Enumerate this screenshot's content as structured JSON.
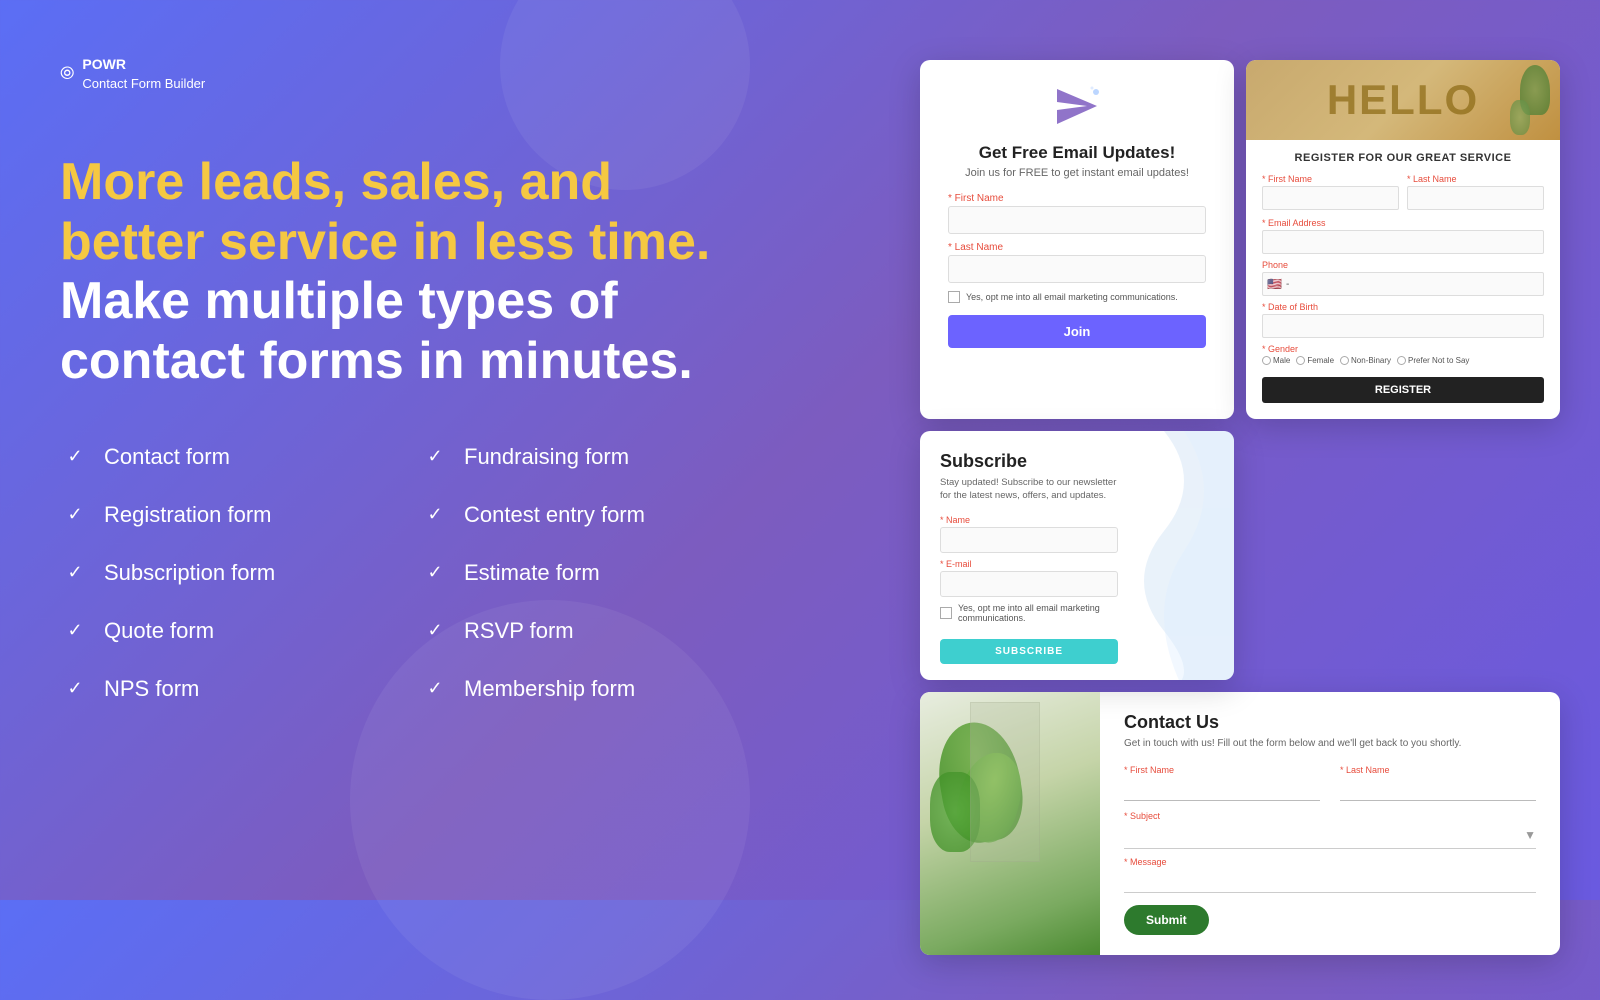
{
  "logo": {
    "icon": "⦾",
    "brand": "POWR",
    "subtitle": "Contact Form Builder"
  },
  "headline": {
    "part1": "More leads, sales, and better service in less time.",
    "part2": "Make multiple types of contact forms in minutes."
  },
  "features": {
    "col1": [
      "Contact form",
      "Registration form",
      "Subscription form",
      "Quote form",
      "NPS form"
    ],
    "col2": [
      "Fundraising form",
      "Contest entry form",
      "Estimate form",
      "RSVP form",
      "Membership form"
    ]
  },
  "form1": {
    "title": "Get Free Email Updates!",
    "subtitle": "Join us for FREE to get instant email updates!",
    "field1_label": "* First Name",
    "field2_label": "* Last Name",
    "checkbox_label": "Yes, opt me into all email marketing communications.",
    "button": "Join"
  },
  "form2": {
    "header_text": "HELLO",
    "title": "REGISTER FOR OUR GREAT SERVICE",
    "first_name_label": "* First Name",
    "last_name_label": "* Last Name",
    "email_label": "* Email Address",
    "phone_label": "Phone",
    "dob_label": "* Date of Birth",
    "gender_label": "* Gender",
    "genders": [
      "Male",
      "Female",
      "Non-Binary",
      "Prefer Not to Say"
    ],
    "button": "REGISTER"
  },
  "form3": {
    "title": "Subscribe",
    "description": "Stay updated! Subscribe to our newsletter for the latest news, offers, and updates.",
    "name_label": "* Name",
    "email_label": "* E-mail",
    "checkbox_label": "Yes, opt me into all email marketing communications.",
    "button": "SUBSCRIBE"
  },
  "form4": {
    "title": "Contact Us",
    "description": "Get in touch with us! Fill out the form below and we'll get back to you shortly.",
    "first_name_label": "* First Name",
    "last_name_label": "* Last Name",
    "subject_label": "* Subject",
    "message_label": "* Message",
    "button": "Submit"
  }
}
